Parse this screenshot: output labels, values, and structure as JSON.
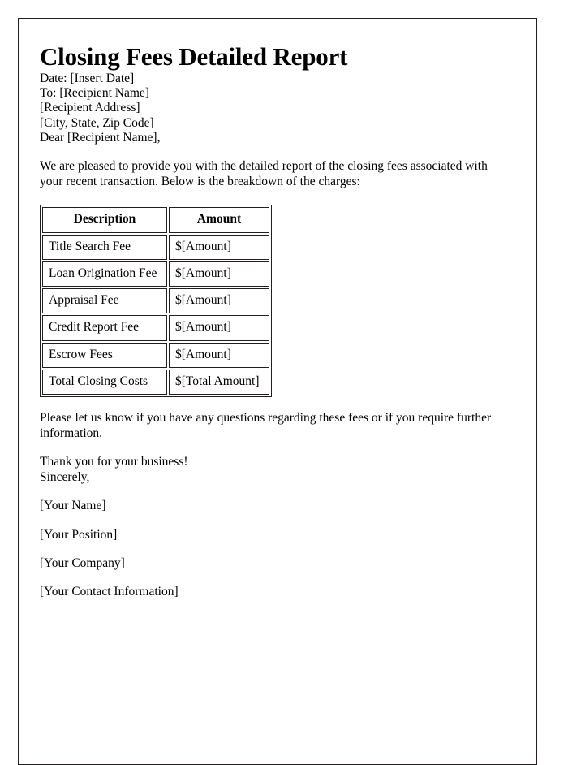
{
  "document": {
    "title": "Closing Fees Detailed Report",
    "header_lines": [
      "Date: [Insert Date]",
      "To: [Recipient Name]",
      "[Recipient Address]",
      "[City, State, Zip Code]"
    ],
    "salutation": "Dear [Recipient Name],",
    "intro_paragraph": "We are pleased to provide you with the detailed report of the closing fees associated with your recent transaction. Below is the breakdown of the charges:",
    "table": {
      "columns": [
        "Description",
        "Amount"
      ],
      "rows": [
        {
          "description": "Title Search Fee",
          "amount": "$[Amount]"
        },
        {
          "description": "Loan Origination Fee",
          "amount": "$[Amount]"
        },
        {
          "description": "Appraisal Fee",
          "amount": "$[Amount]"
        },
        {
          "description": "Credit Report Fee",
          "amount": "$[Amount]"
        },
        {
          "description": "Escrow Fees",
          "amount": "$[Amount]"
        },
        {
          "description": "Total Closing Costs",
          "amount": "$[Total Amount]"
        }
      ]
    },
    "closing_paragraph": "Please let us know if you have any questions regarding these fees or if you require further information.",
    "thanks_line": "Thank you for your business!",
    "signoff": "Sincerely,",
    "signature_lines": [
      "[Your Name]",
      "[Your Position]",
      "[Your Company]",
      "[Your Contact Information]"
    ]
  },
  "colors": {
    "page_border": "#231f20",
    "text": "#000000",
    "background": "#ffffff"
  }
}
